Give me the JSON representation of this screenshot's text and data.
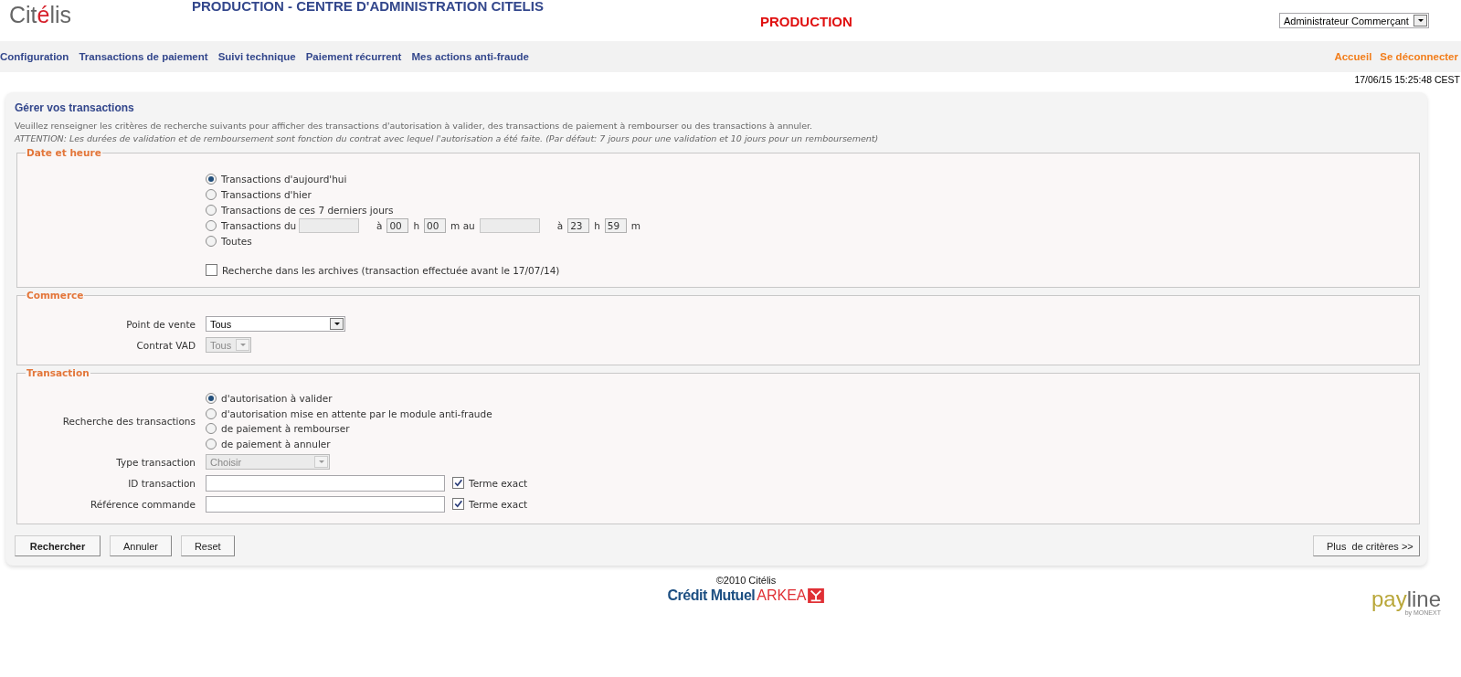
{
  "header": {
    "logo": [
      {
        "text": "Cit",
        "accent": false
      },
      {
        "text": "é",
        "accent": true
      },
      {
        "text": "lis",
        "accent": false
      }
    ],
    "title": "PRODUCTION - CENTRE D'ADMINISTRATION CITELIS",
    "environment": "PRODUCTION",
    "profile_select": {
      "value": "Administrateur Commerçant"
    }
  },
  "nav": {
    "items": [
      "Configuration",
      "Transactions de paiement",
      "Suivi technique",
      "Paiement récurrent",
      "Mes actions anti-fraude"
    ],
    "right_links": [
      "Accueil",
      "Se déconnecter"
    ]
  },
  "datetime": "17/06/15 15:25:48 CEST",
  "panel": {
    "title": "Gérer vos transactions",
    "intro": "Veuillez renseigner les critères de recherche suivants pour afficher des transactions d'autorisation à valider, des transactions de paiement à rembourser ou des transactions à annuler.",
    "warning": "ATTENTION: Les durées de validation et de remboursement sont fonction du contrat avec lequel l'autorisation a été faite. (Par défaut: 7 jours pour une validation et 10 jours pour un remboursement)"
  },
  "date_section": {
    "legend": "Date et heure",
    "options": [
      {
        "kind": "simple",
        "label": "Transactions d'aujourd'hui",
        "selected": true
      },
      {
        "kind": "simple",
        "label": "Transactions d'hier",
        "selected": false
      },
      {
        "kind": "simple",
        "label": "Transactions de ces 7 derniers jours",
        "selected": false
      },
      {
        "kind": "range",
        "label": "Transactions du",
        "selected": false,
        "dates_disabled": true,
        "range": {
          "start_at": "à",
          "start_hour": "00",
          "start_hour_unit": "h",
          "start_minute": "00",
          "until": "m au",
          "end_at": "à",
          "end_hour": "23",
          "end_hour_unit": "h",
          "end_minute": "59",
          "end_minute_unit": "m"
        }
      },
      {
        "kind": "simple",
        "label": "Toutes",
        "selected": false
      }
    ],
    "archive": {
      "label": "Recherche dans les archives (transaction effectuée avant le 17/07/14)",
      "checked": false
    }
  },
  "commerce": {
    "legend": "Commerce",
    "fields": [
      {
        "label": "Point de vente",
        "value": "Tous",
        "disabled": false
      },
      {
        "label": "Contrat VAD",
        "value": "Tous",
        "disabled": true
      }
    ]
  },
  "transaction": {
    "legend": "Transaction",
    "search": {
      "label": "Recherche des transactions",
      "options": [
        {
          "label": "d'autorisation à valider",
          "selected": true
        },
        {
          "label": "d'autorisation mise en attente par le module anti-fraude",
          "selected": false
        },
        {
          "label": "de paiement à rembourser",
          "selected": false
        },
        {
          "label": "de paiement à annuler",
          "selected": false
        }
      ]
    },
    "type": {
      "label": "Type transaction",
      "value": "Choisir",
      "disabled": true
    },
    "text_fields": [
      {
        "label": "ID transaction",
        "exact": {
          "label": "Terme exact",
          "checked": true
        }
      },
      {
        "label": "Référence commande",
        "exact": {
          "label": "Terme exact",
          "checked": true
        }
      }
    ]
  },
  "buttons": [
    {
      "label": "Rechercher",
      "primary": true
    },
    {
      "label": "Annuler",
      "primary": false
    },
    {
      "label": "Reset",
      "primary": false
    }
  ],
  "more_button": "Plus  de critères >>",
  "footer": {
    "copyright": "©2010 Citélis",
    "bank_logo": {
      "name": "Crédit Mutuel",
      "brand": "ARKEA"
    },
    "partner_logo": {
      "first": "pay",
      "second": "line",
      "tagline": "by MONEXT"
    }
  }
}
